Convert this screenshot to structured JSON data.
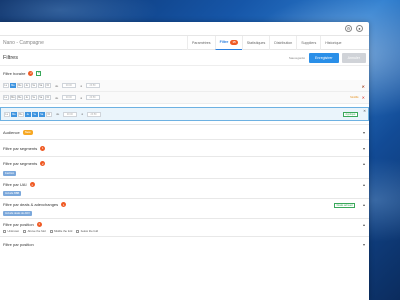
{
  "header": {
    "breadcrumb": "Nano - Campagne",
    "tabs": [
      {
        "label": "Paramètres"
      },
      {
        "label": "Filtre",
        "badge": "15"
      },
      {
        "label": "Statistiques"
      },
      {
        "label": "Distribution"
      },
      {
        "label": "Suppliers"
      },
      {
        "label": "Historique"
      }
    ]
  },
  "toolbar": {
    "page_title": "Filtres",
    "saved_text": "Sauvegardé",
    "save_label": "Enregistrer",
    "cancel_label": "Annuler"
  },
  "hours": {
    "title": "Filtre horaire",
    "badge": "2",
    "add": "+",
    "days": [
      "Lu",
      "Ma",
      "Me",
      "Je",
      "Ve",
      "Sa",
      "Di"
    ],
    "from_label": "de",
    "to_label": "à",
    "from_placeholder": "00:00",
    "to_placeholder": "23:59",
    "rows": [
      {
        "active": [
          false,
          true,
          false,
          false,
          false,
          false,
          false
        ],
        "status": ""
      },
      {
        "active": [
          false,
          false,
          false,
          false,
          false,
          false,
          false
        ],
        "status": "Modifié"
      },
      {
        "active": [
          false,
          true,
          false,
          true,
          true,
          true,
          false
        ],
        "status": "Appliqué"
      }
    ]
  },
  "sections": {
    "audience": {
      "title": "Audience",
      "pill": "New"
    },
    "segments1": {
      "title": "Filtre par segments",
      "badge": "1"
    },
    "segments2": {
      "title": "Filtre par segments",
      "badge": "2",
      "chip": "Fashion"
    },
    "uai": {
      "title": "Filtre par UAI",
      "badge": "1",
      "chip": "Include BBB"
    },
    "deals": {
      "title": "Filtre par deals & adexchanges",
      "badge": "1",
      "chip": "Include deals de ADX",
      "tag": "Deals ad lead"
    },
    "position": {
      "title": "Filtre par position",
      "badge": "1",
      "options": [
        "Unknown",
        "Above the fold",
        "Middle the fold",
        "below the fold"
      ]
    },
    "position2": {
      "title": "Filtre par position"
    }
  },
  "icons": {
    "topbar": [
      "settings-icon",
      "user-icon"
    ]
  }
}
